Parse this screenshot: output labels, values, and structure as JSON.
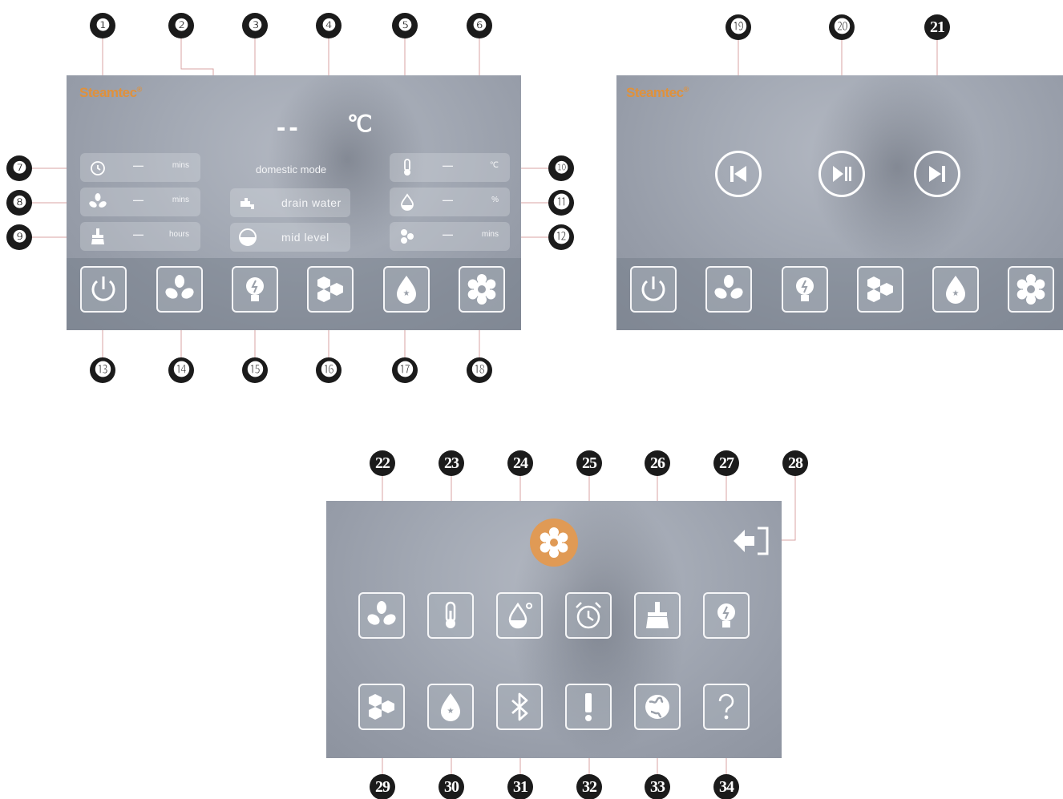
{
  "brand": {
    "name": "Steamtec",
    "mark": "®"
  },
  "main_screen": {
    "temp_display": "--",
    "temp_unit": "℃",
    "mode_label": "domestic mode",
    "left_rows": [
      {
        "icon": "alarm-clock-icon",
        "value": "—",
        "unit": "mins"
      },
      {
        "icon": "fan-icon",
        "value": "—",
        "unit": "mins"
      },
      {
        "icon": "broom-icon",
        "value": "—",
        "unit": "hours"
      }
    ],
    "right_rows": [
      {
        "icon": "thermometer-icon",
        "value": "—",
        "unit": "℃"
      },
      {
        "icon": "humidity-drop-icon",
        "value": "—",
        "unit": "%"
      },
      {
        "icon": "aroma-icon",
        "value": "—",
        "unit": "mins"
      }
    ],
    "center_rows": [
      {
        "icon": "faucet-icon",
        "label": "drain water"
      },
      {
        "icon": "water-level-icon",
        "label": "mid  level"
      }
    ],
    "bottom_bar": [
      "power-icon",
      "fan-icon",
      "light-bulb-icon",
      "aroma-icon",
      "essence-bottle-icon",
      "gear-icon"
    ]
  },
  "music_screen": {
    "controls": [
      "previous-track-icon",
      "play-pause-icon",
      "next-track-icon"
    ],
    "bottom_bar": [
      "power-icon",
      "fan-icon",
      "light-bulb-icon",
      "aroma-icon",
      "essence-bottle-icon",
      "gear-icon"
    ]
  },
  "settings_screen": {
    "header_icon": "gear-icon",
    "exit_icon": "exit-icon",
    "row1": [
      "fan-icon",
      "thermometer-icon",
      "humidity-drop-icon",
      "alarm-clock-icon",
      "broom-icon",
      "light-bulb-icon"
    ],
    "row2": [
      "aroma-icon",
      "essence-bottle-icon",
      "bluetooth-icon",
      "exclamation-icon",
      "globe-icon",
      "help-icon"
    ]
  },
  "callouts": {
    "top_main": [
      "❶",
      "❷",
      "❸",
      "❹",
      "❺",
      "❻"
    ],
    "left_main": [
      "❼",
      "❽",
      "❾"
    ],
    "right_main": [
      "❿",
      "⓫",
      "⓬"
    ],
    "bottom_main": [
      "⓭",
      "⓮",
      "⓯",
      "⓰",
      "⓱",
      "⓲"
    ],
    "music": [
      "⓳",
      "⓴",
      "21"
    ],
    "settings_top": [
      "22",
      "23",
      "24",
      "25",
      "26",
      "27",
      "28"
    ],
    "settings_bottom": [
      "29",
      "30",
      "31",
      "32",
      "33",
      "34"
    ]
  },
  "colors": {
    "brand_orange": "#e0913b",
    "panel": "#a4aab5",
    "badge": "#1b1b1b"
  }
}
